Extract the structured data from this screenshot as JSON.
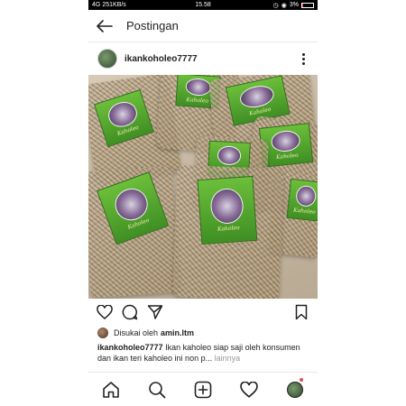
{
  "status_bar": {
    "signal": "4G",
    "speed": "251KB/s",
    "time": "15.58",
    "battery": "3%"
  },
  "header": {
    "title": "Postingan"
  },
  "post": {
    "username": "ikankoholeo7777",
    "product_label_text": "Kaholeo",
    "liked_by_prefix": "Disukai oleh",
    "liked_by_user": "amin.ltm",
    "caption_user": "ikankoholeo7777",
    "caption_text": "Ikan kaholeo siap saji oleh konsumen dan ikan teri kaholeo ini non p...",
    "caption_more": "lainnya"
  },
  "icons": {
    "back": "back-arrow-icon",
    "more": "more-vertical-icon",
    "like": "heart-icon",
    "comment": "comment-icon",
    "share": "send-icon",
    "bookmark": "bookmark-icon",
    "home": "home-icon",
    "search": "search-icon",
    "add": "add-post-icon",
    "activity": "heart-icon",
    "profile": "profile-avatar"
  }
}
